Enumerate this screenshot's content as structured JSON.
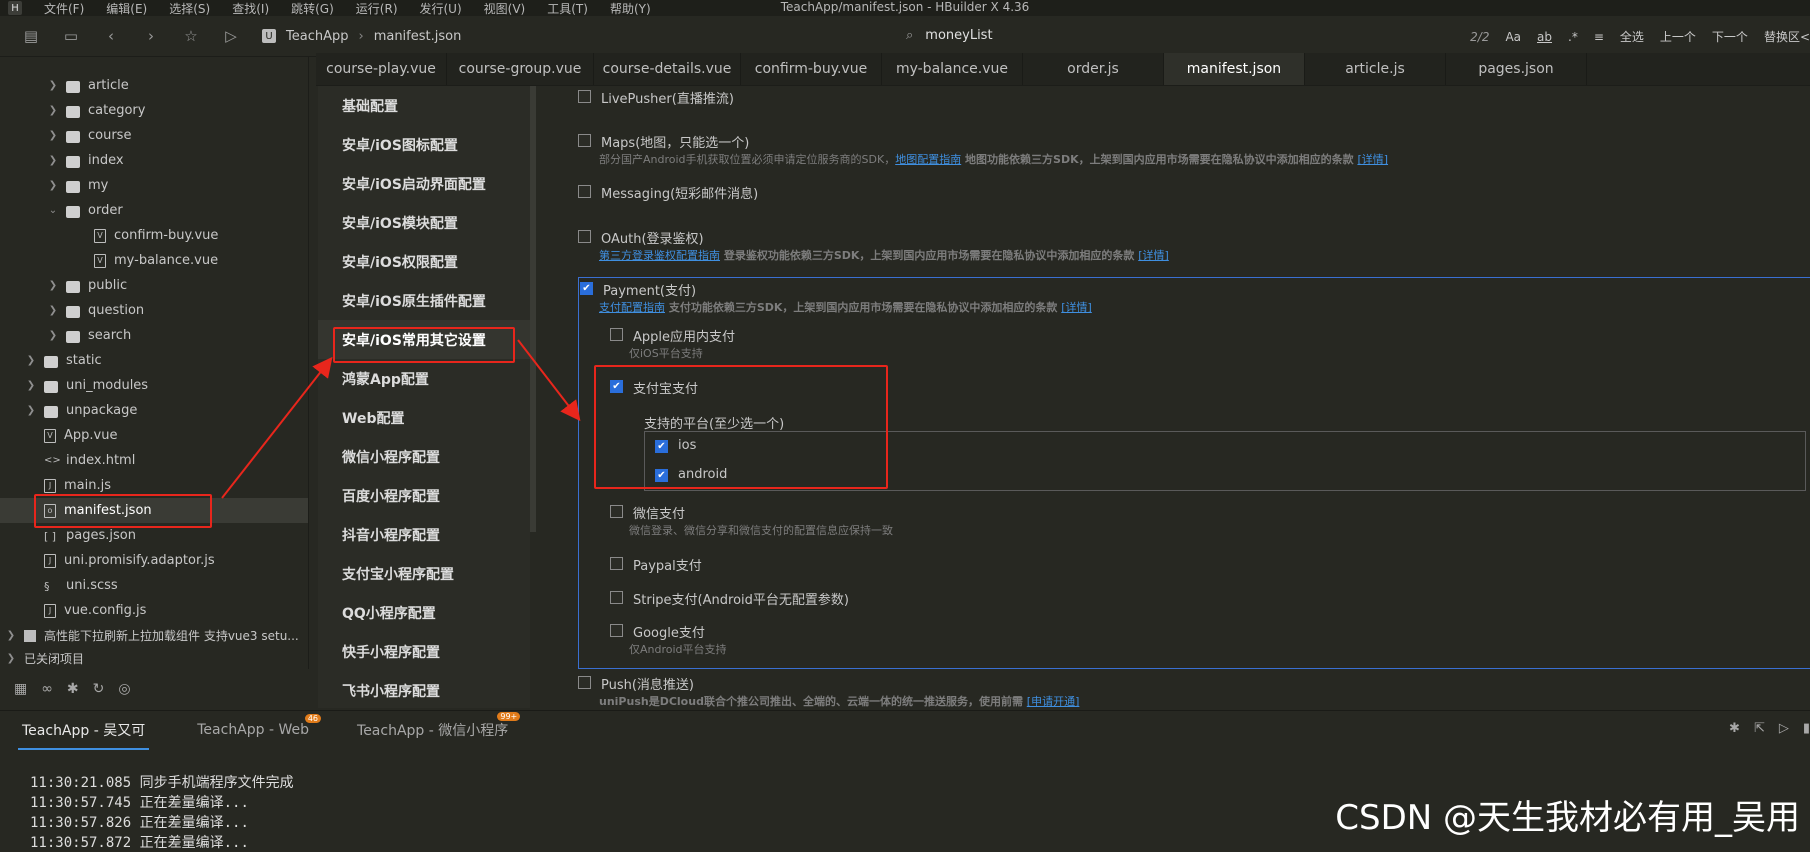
{
  "window": {
    "title": "TeachApp/manifest.json - HBuilder X 4.36",
    "menu": [
      "文件(F)",
      "编辑(E)",
      "选择(S)",
      "查找(I)",
      "跳转(G)",
      "运行(R)",
      "发行(U)",
      "视图(V)",
      "工具(T)",
      "帮助(Y)"
    ]
  },
  "toolbar": {
    "breadcrumb_project": "TeachApp",
    "breadcrumb_file": "manifest.json",
    "search_text": "moneyList",
    "match_count": "2/2",
    "case_label": "Aa",
    "word_label": "ab",
    "regex_label": ".*",
    "select_all": "全选",
    "prev": "上一个",
    "next": "下一个",
    "replace": "替换区<"
  },
  "sidebar": {
    "items": [
      {
        "label": "article",
        "type": "folder"
      },
      {
        "label": "category",
        "type": "folder"
      },
      {
        "label": "course",
        "type": "folder"
      },
      {
        "label": "index",
        "type": "folder"
      },
      {
        "label": "my",
        "type": "folder"
      },
      {
        "label": "order",
        "type": "folder"
      },
      {
        "label": "confirm-buy.vue",
        "type": "file"
      },
      {
        "label": "my-balance.vue",
        "type": "file"
      },
      {
        "label": "public",
        "type": "folder"
      },
      {
        "label": "question",
        "type": "folder"
      },
      {
        "label": "search",
        "type": "folder"
      },
      {
        "label": "static",
        "type": "folder"
      },
      {
        "label": "uni_modules",
        "type": "folder"
      },
      {
        "label": "unpackage",
        "type": "folder"
      },
      {
        "label": "App.vue",
        "type": "file"
      },
      {
        "label": "index.html",
        "type": "file"
      },
      {
        "label": "main.js",
        "type": "file"
      },
      {
        "label": "manifest.json",
        "type": "file"
      },
      {
        "label": "pages.json",
        "type": "file"
      },
      {
        "label": "uni.promisify.adaptor.js",
        "type": "file"
      },
      {
        "label": "uni.scss",
        "type": "file"
      },
      {
        "label": "vue.config.js",
        "type": "file"
      },
      {
        "label": "高性能下拉刷新上拉加载组件 支持vue3 setu...",
        "type": "project"
      },
      {
        "label": "已关闭项目",
        "type": "group"
      }
    ]
  },
  "tabs": [
    "course-play.vue",
    "course-group.vue",
    "course-details.vue",
    "confirm-buy.vue",
    "my-balance.vue",
    "order.js",
    "manifest.json",
    "article.js",
    "pages.json"
  ],
  "active_tab": "manifest.json",
  "settings_nav": [
    "基础配置",
    "安卓/iOS图标配置",
    "安卓/iOS启动界面配置",
    "安卓/iOS模块配置",
    "安卓/iOS权限配置",
    "安卓/iOS原生插件配置",
    "安卓/iOS常用其它设置",
    "鸿蒙App配置",
    "Web配置",
    "微信小程序配置",
    "百度小程序配置",
    "抖音小程序配置",
    "支付宝小程序配置",
    "QQ小程序配置",
    "快手小程序配置",
    "飞书小程序配置"
  ],
  "modules": {
    "livepusher": "LivePusher(直播推流)",
    "maps": "Maps(地图，只能选一个)",
    "maps_desc": "部分国产Android手机获取位置必须申请定位服务商的SDK，",
    "maps_link": "地图配置指南",
    "maps_desc2": " 地图功能依赖三方SDK，上架到国内应用市场需要在隐私协议中添加相应的条款 ",
    "maps_detail": "[详情]",
    "messaging": "Messaging(短彩邮件消息)",
    "oauth": "OAuth(登录鉴权)",
    "oauth_link": "第三方登录鉴权配置指南",
    "oauth_desc": " 登录鉴权功能依赖三方SDK，上架到国内应用市场需要在隐私协议中添加相应的条款 ",
    "oauth_detail": "[详情]",
    "payment": "Payment(支付)",
    "payment_link": "支付配置指南",
    "payment_desc": " 支付功能依赖三方SDK，上架到国内应用市场需要在隐私协议中添加相应的条款 ",
    "payment_detail": "[详情]",
    "apple_pay": "Apple应用内支付",
    "apple_pay_desc": "仅iOS平台支持",
    "alipay": "支付宝支付",
    "platform_label": "支持的平台(至少选一个)",
    "ios": "ios",
    "android": "android",
    "wechat_pay": "微信支付",
    "wechat_pay_desc": "微信登录、微信分享和微信支付的配置信息应保持一致",
    "paypal": "Paypal支付",
    "stripe": "Stripe支付(Android平台无配置参数)",
    "google_pay": "Google支付",
    "google_pay_desc": "仅Android平台支持",
    "push": "Push(消息推送)",
    "push_desc": "uniPush是DCloud联合个推公司推出、全端的、云端一体的统一推送服务，使用前需 ",
    "push_link": "[申请开通]"
  },
  "console": {
    "tabs": [
      "TeachApp - 吴又可",
      "TeachApp - Web",
      "TeachApp - 微信小程序"
    ],
    "badge_web": "46",
    "badge_wx": "99+",
    "logs": [
      {
        "time": "11:30:21.085",
        "msg": "同步手机端程序文件完成"
      },
      {
        "time": "11:30:57.745",
        "msg": "正在差量编译..."
      },
      {
        "time": "11:30:57.826",
        "msg": "正在差量编译..."
      },
      {
        "time": "11:30:57.872",
        "msg": "正在差量编译..."
      }
    ]
  },
  "watermark": "CSDN @天生我材必有用_吴用",
  "colors": {
    "accent": "#2a6edb",
    "annotation_red": "#e8261c",
    "background": "#272822"
  }
}
